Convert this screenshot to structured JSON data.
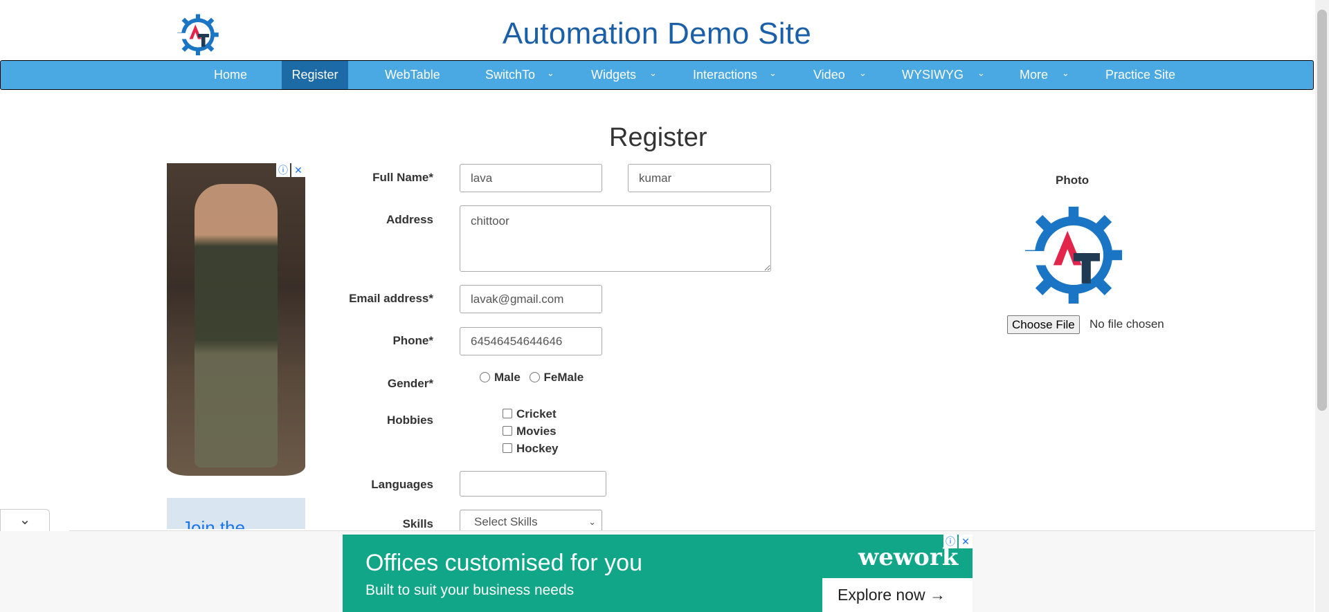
{
  "header": {
    "site_title": "Automation Demo Site",
    "logo_letters": "AT"
  },
  "nav": {
    "items": [
      {
        "label": "Home",
        "has_dropdown": false
      },
      {
        "label": "Register",
        "has_dropdown": false,
        "active": true
      },
      {
        "label": "WebTable",
        "has_dropdown": false
      },
      {
        "label": "SwitchTo",
        "has_dropdown": true
      },
      {
        "label": "Widgets",
        "has_dropdown": true
      },
      {
        "label": "Interactions",
        "has_dropdown": true
      },
      {
        "label": "Video",
        "has_dropdown": true
      },
      {
        "label": "WYSIWYG",
        "has_dropdown": true
      },
      {
        "label": "More",
        "has_dropdown": true
      },
      {
        "label": "Practice Site",
        "has_dropdown": false
      }
    ],
    "chevron": "⌄"
  },
  "form": {
    "title": "Register",
    "full_name_label": "Full Name*",
    "first_name_value": "lava",
    "last_name_value": "kumar",
    "address_label": "Address",
    "address_value": "chittoor",
    "email_label": "Email address*",
    "email_value": "lavak@gmail.com",
    "phone_label": "Phone*",
    "phone_value": "64546454644646",
    "gender_label": "Gender*",
    "gender_options": [
      "Male",
      "FeMale"
    ],
    "hobbies_label": "Hobbies",
    "hobbies_options": [
      "Cricket",
      "Movies",
      "Hockey"
    ],
    "languages_label": "Languages",
    "languages_value": "",
    "skills_label": "Skills",
    "skills_value": "Select Skills"
  },
  "photo": {
    "label": "Photo",
    "choose_file_label": "Choose File",
    "no_file_text": "No file chosen"
  },
  "ads": {
    "side_badge_info": "ⓘ",
    "side_badge_close": "✕",
    "side_bottom_text": "Join the",
    "bottom_headline": "Offices customised for you",
    "bottom_sub": "Built to suit your business needs",
    "bottom_brand": "wework",
    "bottom_cta": "Explore now →"
  },
  "collapse_icon": "⌄",
  "colors": {
    "nav_bg": "#4aa8e3",
    "nav_active": "#1c6aa6",
    "title_blue": "#1a5fa8",
    "logo_gear": "#1a75c4",
    "logo_a": "#e2254a",
    "logo_t": "#1f3a52",
    "ad_green": "#12a689"
  }
}
